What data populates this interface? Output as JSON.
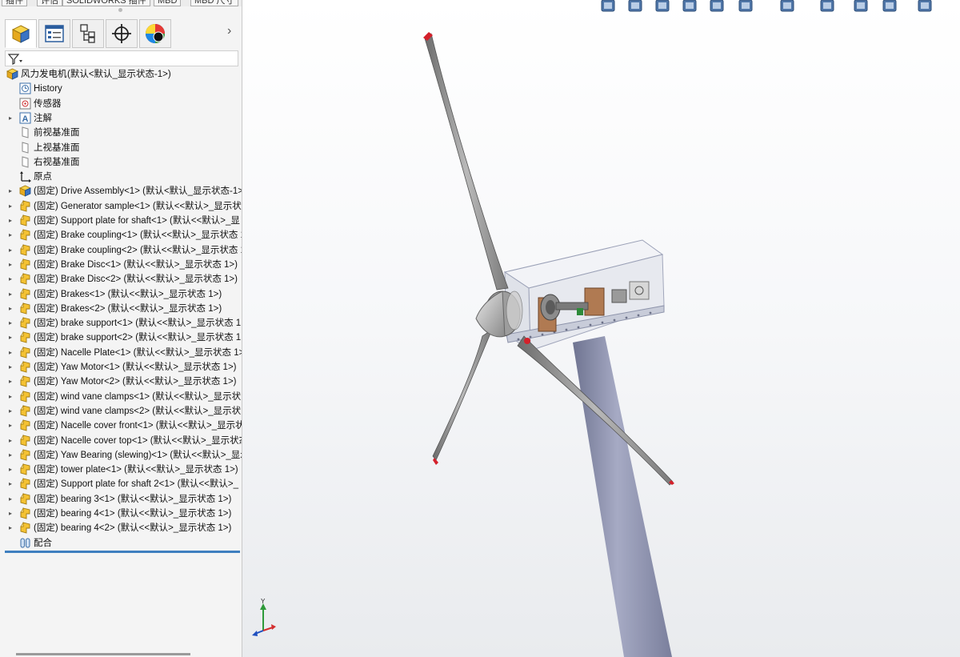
{
  "top_tabs": [
    "插件",
    "评估",
    "SOLIDWORKS 插件",
    "MBD",
    "MBD 尺寸"
  ],
  "manager_tabs": [
    {
      "icon": "feature-manager-icon"
    },
    {
      "icon": "property-manager-icon"
    },
    {
      "icon": "configuration-manager-icon"
    },
    {
      "icon": "dimxpert-manager-icon"
    },
    {
      "icon": "display-manager-icon"
    }
  ],
  "filter_icon": "filter-icon",
  "tree": {
    "root": {
      "label": "风力发电机",
      "suffix": " (默认<默认_显示状态-1>)"
    },
    "system_items": [
      {
        "label": "History",
        "icon": "history-icon",
        "expandable": false
      },
      {
        "label": "传感器",
        "icon": "sensor-icon",
        "expandable": false
      },
      {
        "label": "注解",
        "icon": "annotation-icon",
        "expandable": true
      },
      {
        "label": "前视基准面",
        "icon": "plane-icon",
        "expandable": false
      },
      {
        "label": "上视基准面",
        "icon": "plane-icon",
        "expandable": false
      },
      {
        "label": "右视基准面",
        "icon": "plane-icon",
        "expandable": false
      },
      {
        "label": "原点",
        "icon": "origin-icon",
        "expandable": false
      }
    ],
    "components": [
      {
        "label": "(固定) Drive Assembly<1> (默认<默认_显示状态-1>)",
        "kind": "assembly"
      },
      {
        "label": "(固定) Generator sample<1> (默认<<默认>_显示状",
        "kind": "part"
      },
      {
        "label": "(固定) Support plate for shaft<1> (默认<<默认>_显",
        "kind": "part"
      },
      {
        "label": "(固定) Brake coupling<1> (默认<<默认>_显示状态 1",
        "kind": "part"
      },
      {
        "label": "(固定) Brake coupling<2> (默认<<默认>_显示状态 1",
        "kind": "part"
      },
      {
        "label": "(固定) Brake Disc<1> (默认<<默认>_显示状态 1>)",
        "kind": "part"
      },
      {
        "label": "(固定) Brake Disc<2> (默认<<默认>_显示状态 1>)",
        "kind": "part"
      },
      {
        "label": "(固定) Brakes<1> (默认<<默认>_显示状态 1>)",
        "kind": "part"
      },
      {
        "label": "(固定) Brakes<2> (默认<<默认>_显示状态 1>)",
        "kind": "part"
      },
      {
        "label": "(固定) brake support<1> (默认<<默认>_显示状态 1:",
        "kind": "part"
      },
      {
        "label": "(固定) brake support<2> (默认<<默认>_显示状态 1:",
        "kind": "part"
      },
      {
        "label": "(固定) Nacelle Plate<1> (默认<<默认>_显示状态 1>",
        "kind": "part"
      },
      {
        "label": "(固定) Yaw Motor<1> (默认<<默认>_显示状态 1>)",
        "kind": "part"
      },
      {
        "label": "(固定) Yaw Motor<2> (默认<<默认>_显示状态 1>)",
        "kind": "part"
      },
      {
        "label": "(固定) wind vane clamps<1> (默认<<默认>_显示状",
        "kind": "part"
      },
      {
        "label": "(固定) wind vane clamps<2> (默认<<默认>_显示状",
        "kind": "part"
      },
      {
        "label": "(固定) Nacelle cover front<1> (默认<<默认>_显示状",
        "kind": "part"
      },
      {
        "label": "(固定) Nacelle cover top<1> (默认<<默认>_显示状态",
        "kind": "part"
      },
      {
        "label": "(固定) Yaw Bearing (slewing)<1> (默认<<默认>_显示",
        "kind": "part"
      },
      {
        "label": "(固定) tower plate<1> (默认<<默认>_显示状态 1>)",
        "kind": "part"
      },
      {
        "label": "(固定) Support plate for shaft 2<1> (默认<<默认>_",
        "kind": "part"
      },
      {
        "label": "(固定) bearing 3<1> (默认<<默认>_显示状态 1>)",
        "kind": "part"
      },
      {
        "label": "(固定) bearing 4<1> (默认<<默认>_显示状态 1>)",
        "kind": "part"
      },
      {
        "label": "(固定) bearing 4<2> (默认<<默认>_显示状态 1>)",
        "kind": "part"
      }
    ],
    "mates": {
      "label": "配合",
      "icon": "mates-icon"
    }
  },
  "heads_up_toolbar": [
    "zoom-to-fit-icon",
    "zoom-to-area-icon",
    "previous-view-icon",
    "section-view-icon",
    "dynamic-annotation-view-icon",
    "view-orientation-icon",
    "display-style-icon",
    "hide-show-items-icon",
    "edit-appearance-icon",
    "apply-scene-icon",
    "view-settings-icon"
  ],
  "triad": {
    "y_label": "Y"
  },
  "colors": {
    "tree_selection": "#3f7fbf",
    "blade_tip": "#d4202a",
    "tower": "#8f93ad"
  }
}
